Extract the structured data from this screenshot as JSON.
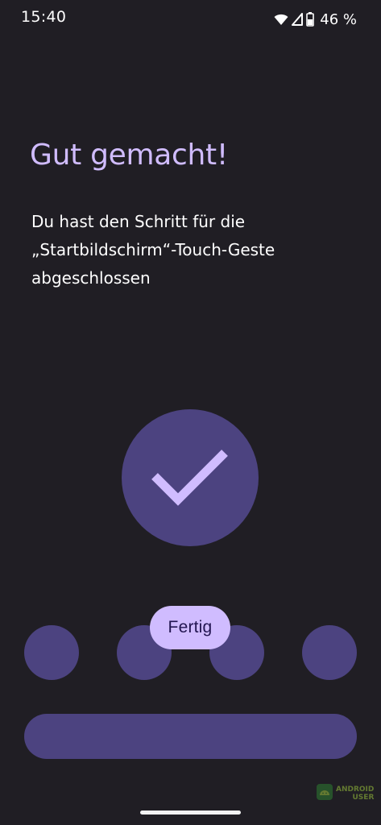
{
  "status_bar": {
    "time": "15:40",
    "battery": "46 %",
    "icons": [
      "wifi-icon",
      "signal-icon",
      "battery-icon"
    ]
  },
  "page": {
    "title": "Gut gemacht!",
    "subtitle": "Du hast den Schritt für die\n„Startbildschirm“-Touch-Geste\nabgeschlossen"
  },
  "done_button": {
    "label": "Fertig"
  },
  "watermark": {
    "line1": "ANDROID",
    "line2": "USER"
  },
  "colors": {
    "background": "#201e24",
    "accent": "#d0bcff",
    "shape": "#4c4380"
  }
}
